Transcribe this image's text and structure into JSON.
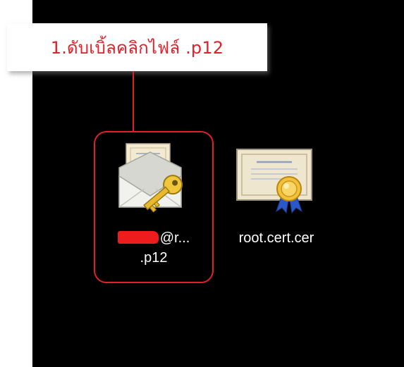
{
  "callout": {
    "text": "1.ดับเบิ้ลคลิกไฟล์ .p12"
  },
  "desktop": {
    "files": [
      {
        "label_line1_suffix": "@r...",
        "label_line2": ".p12",
        "icon": "certificate-envelope-key-icon",
        "redacted": true
      },
      {
        "label": "root.cert.cer",
        "icon": "certificate-seal-icon"
      }
    ]
  },
  "colors": {
    "annotation": "#e0202a",
    "desktop_bg": "#000000",
    "label_text": "#ffffff",
    "redaction": "#ee1c1c"
  }
}
